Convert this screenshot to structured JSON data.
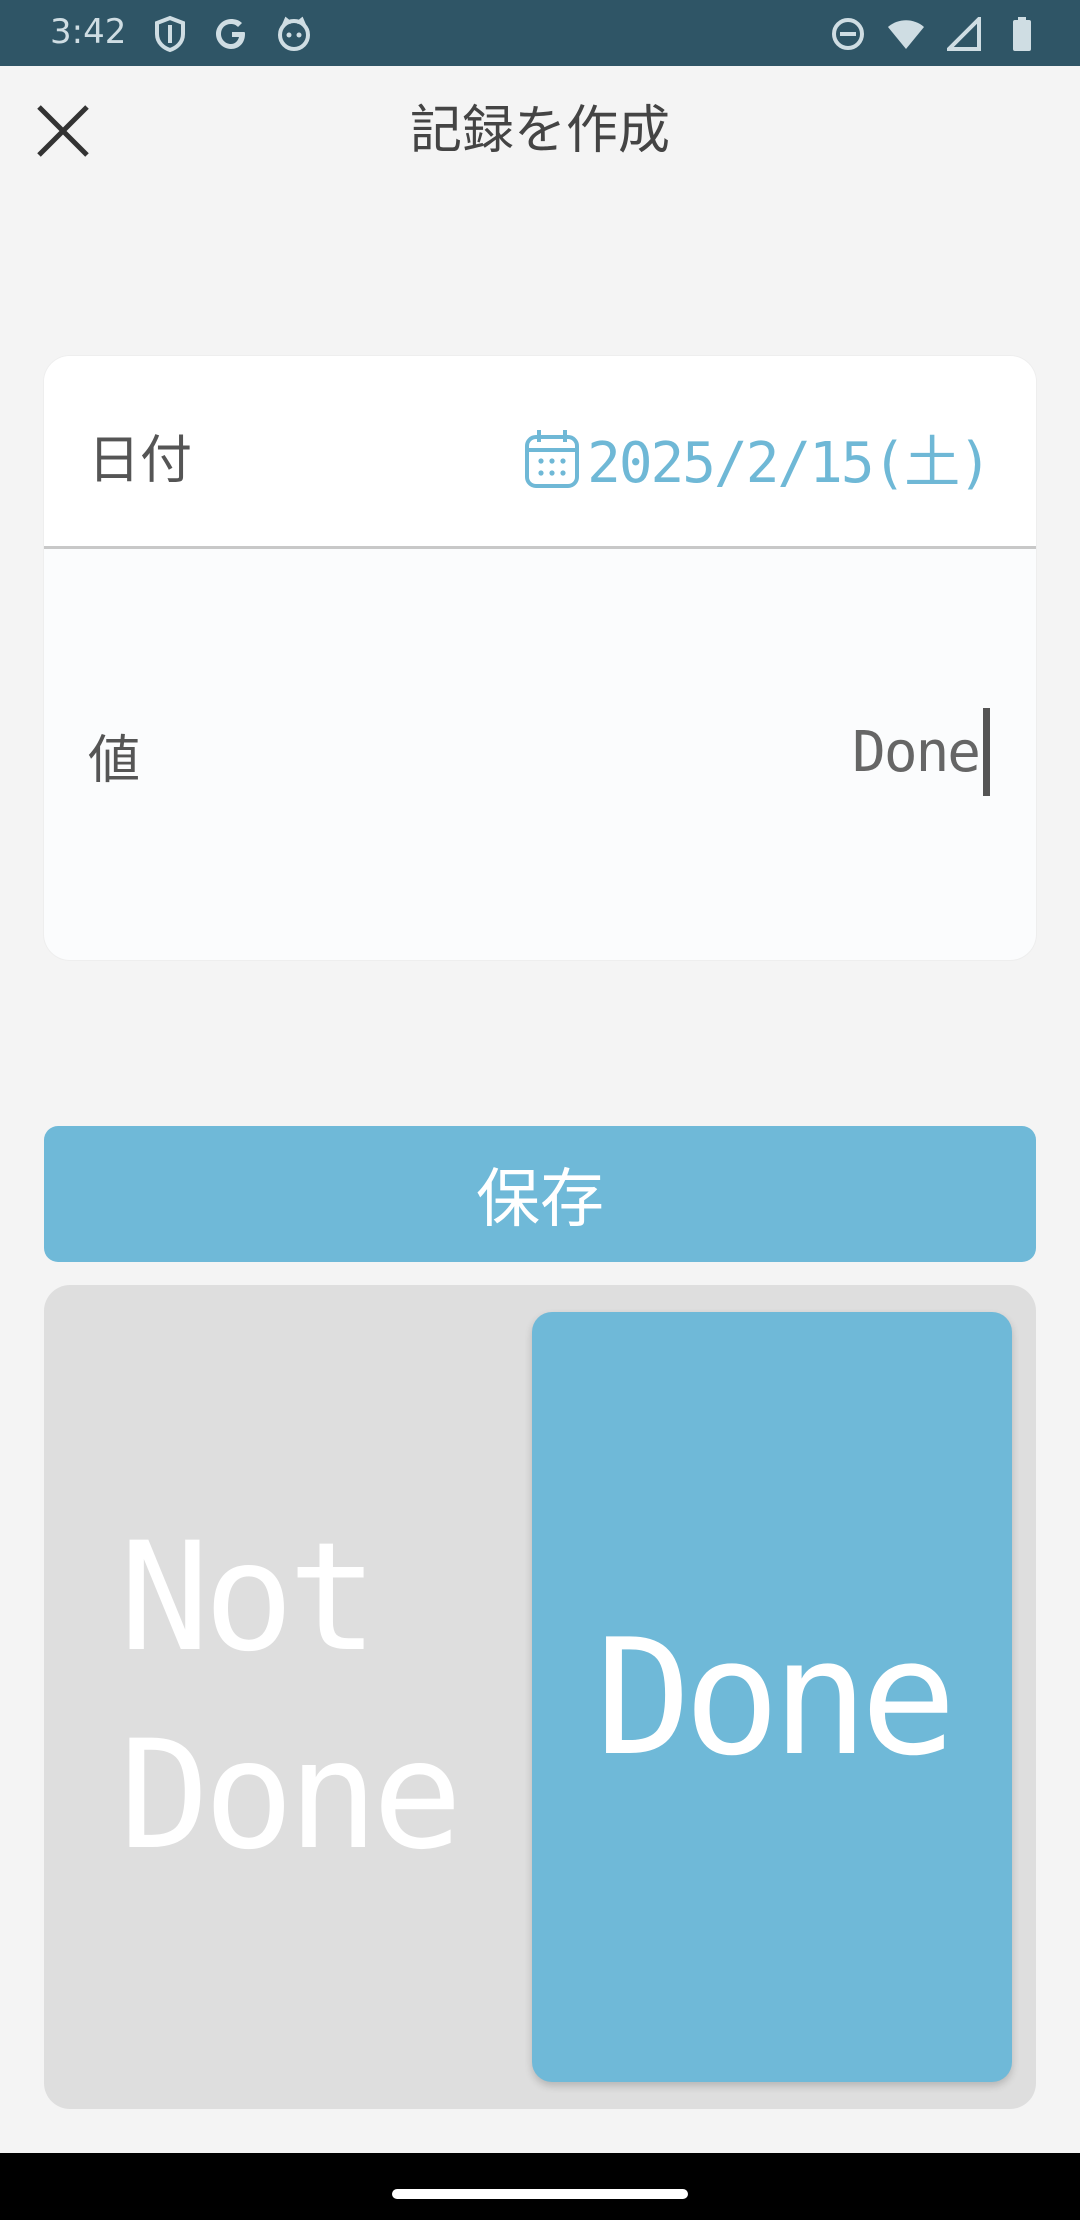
{
  "status_bar": {
    "time": "3:42",
    "icons_left": [
      "shield-icon",
      "google-icon",
      "cat-icon"
    ],
    "icons_right": [
      "dnd-icon",
      "wifi-icon",
      "signal-icon",
      "battery-icon"
    ]
  },
  "app_bar": {
    "title": "記録を作成",
    "close_icon": "close-icon"
  },
  "form": {
    "date_label": "日付",
    "date_value": "2025/2/15(土)",
    "date_icon": "calendar-icon",
    "value_label": "値",
    "value_input": "Done"
  },
  "save_button": {
    "label": "保存"
  },
  "toggle": {
    "not_done_line1": "Not",
    "not_done_line2": "Done",
    "done_label": "Done",
    "selected": "Done"
  },
  "colors": {
    "accent": "#6fb9d8",
    "status_bar": "#2f5566",
    "background": "#f4f4f4",
    "toggle_background": "#dedede"
  }
}
